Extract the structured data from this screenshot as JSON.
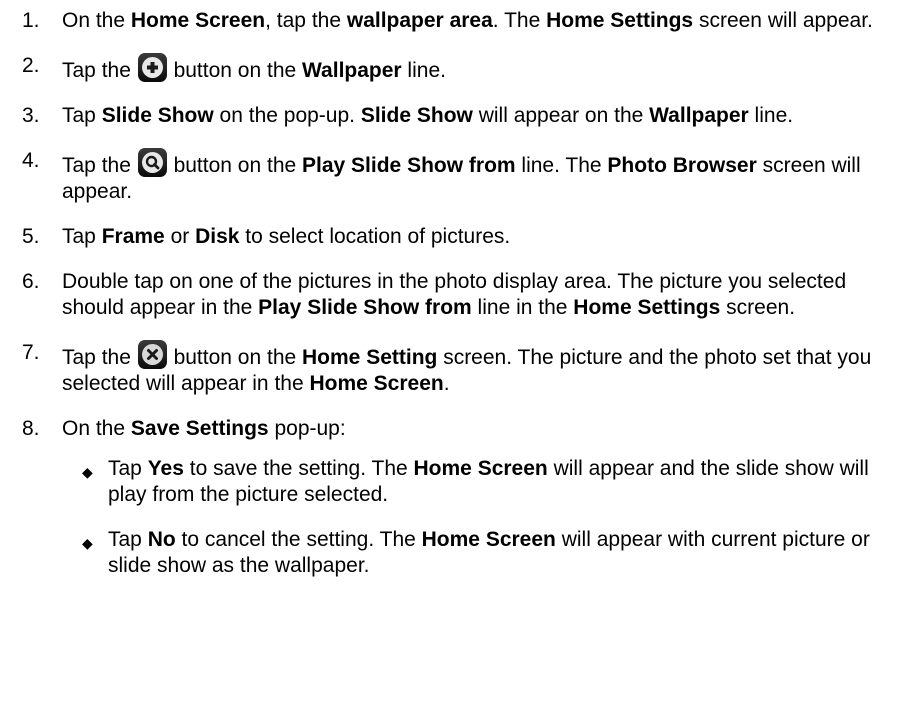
{
  "steps": [
    {
      "num": "1.",
      "parts": [
        {
          "t": "On the "
        },
        {
          "b": "Home Screen"
        },
        {
          "t": ", tap the "
        },
        {
          "b": "wallpaper area"
        },
        {
          "t": ".  The "
        },
        {
          "b": "Home Settings"
        },
        {
          "t": " screen will appear."
        }
      ]
    },
    {
      "num": "2.",
      "parts": [
        {
          "t": "Tap the "
        },
        {
          "icon": "plus-icon"
        },
        {
          "t": " button on the "
        },
        {
          "b": "Wallpaper"
        },
        {
          "t": " line."
        }
      ]
    },
    {
      "num": "3.",
      "parts": [
        {
          "t": "Tap "
        },
        {
          "b": "Slide Show"
        },
        {
          "t": " on the pop-up.  "
        },
        {
          "b": "Slide Show"
        },
        {
          "t": " will appear on the "
        },
        {
          "b": "Wallpaper"
        },
        {
          "t": " line."
        }
      ]
    },
    {
      "num": "4.",
      "parts": [
        {
          "t": "Tap the "
        },
        {
          "icon": "search-icon"
        },
        {
          "t": " button on the "
        },
        {
          "b": "Play Slide Show from"
        },
        {
          "t": " line.  The "
        },
        {
          "b": "Photo Browser"
        },
        {
          "t": " screen will appear."
        }
      ]
    },
    {
      "num": "5.",
      "parts": [
        {
          "t": "Tap "
        },
        {
          "b": "Frame"
        },
        {
          "t": " or "
        },
        {
          "b": "Disk"
        },
        {
          "t": " to select location of pictures."
        }
      ]
    },
    {
      "num": "6.",
      "parts": [
        {
          "t": "Double tap on one of the pictures in the photo display area.  The picture you selected should appear in the "
        },
        {
          "b": "Play Slide Show from"
        },
        {
          "t": " line in the "
        },
        {
          "b": "Home Settings"
        },
        {
          "t": " screen."
        }
      ]
    },
    {
      "num": "7.",
      "parts": [
        {
          "t": "Tap the "
        },
        {
          "icon": "close-icon"
        },
        {
          "t": " button on the "
        },
        {
          "b": "Home Setting"
        },
        {
          "t": " screen.  The picture and the photo set that you selected will appear in the "
        },
        {
          "b": "Home Screen"
        },
        {
          "t": "."
        }
      ]
    },
    {
      "num": "8.",
      "parts": [
        {
          "t": "On the "
        },
        {
          "b": "Save Settings"
        },
        {
          "t": " pop-up:"
        }
      ],
      "sub": [
        {
          "parts": [
            {
              "t": "Tap "
            },
            {
              "b": "Yes"
            },
            {
              "t": " to save the setting.  The "
            },
            {
              "b": "Home Screen"
            },
            {
              "t": " will appear and the slide show will play from the picture selected."
            }
          ]
        },
        {
          "parts": [
            {
              "t": "Tap "
            },
            {
              "b": "No"
            },
            {
              "t": " to cancel the setting.  The "
            },
            {
              "b": "Home Screen"
            },
            {
              "t": " will appear with current picture or slide show as the wallpaper."
            }
          ]
        }
      ]
    }
  ],
  "bullet_glyph": "◆"
}
